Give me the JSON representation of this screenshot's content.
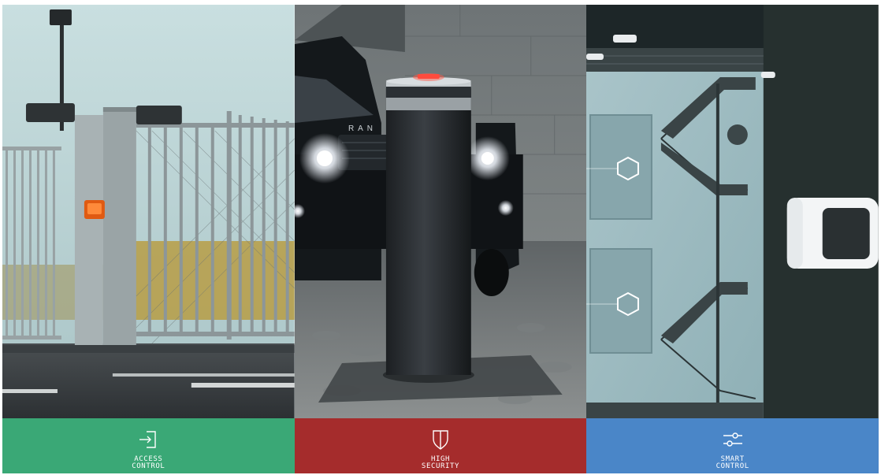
{
  "panels": [
    {
      "id": "access",
      "label_line1": "ACCESS",
      "label_line2": "CONTROL",
      "icon": "sign-in-icon",
      "color": "#3aa876"
    },
    {
      "id": "security",
      "label_line1": "HIGH",
      "label_line2": "SECURITY",
      "icon": "shield-icon",
      "color": "#a52c2c"
    },
    {
      "id": "smart",
      "label_line1": "SMART",
      "label_line2": "CONTROL",
      "icon": "sliders-icon",
      "color": "#4a86c8"
    }
  ],
  "vehicle_badge": "RAN"
}
